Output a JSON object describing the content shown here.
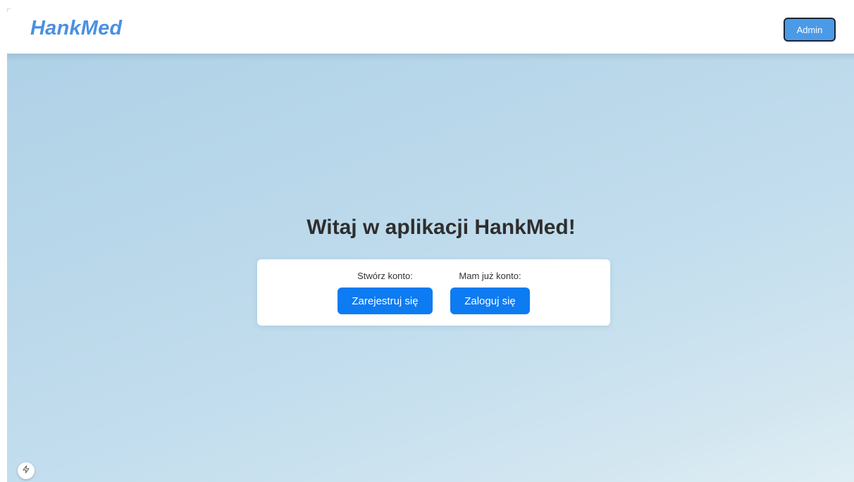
{
  "header": {
    "brand": "HankMed",
    "admin_label": "Admin"
  },
  "main": {
    "welcome": "Witaj w aplikacji HankMed!",
    "register": {
      "label": "Stwórz konto:",
      "button": "Zarejestruj się"
    },
    "login": {
      "label": "Mam już konto:",
      "button": "Zaloguj się"
    }
  },
  "icons": {
    "corner_badge": "bolt-icon"
  },
  "colors": {
    "brand": "#4a90e2",
    "admin_button": "#4a9ae8",
    "primary_button": "#0d7bf2",
    "background_gradient_start": "#afd1e7",
    "background_gradient_end": "#e0eef4"
  }
}
